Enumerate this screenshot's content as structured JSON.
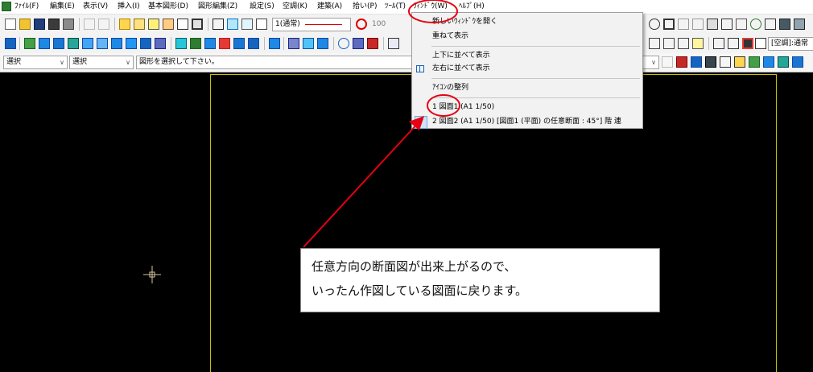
{
  "menubar": {
    "items": [
      "ﾌｧｲﾙ(F)",
      "編集(E)",
      "表示(V)",
      "挿入(I)",
      "基本図形(D)",
      "図形編集(Z)",
      "設定(S)",
      "空調(K)",
      "建築(A)",
      "拾い(P)",
      "ﾂｰﾙ(T)",
      "ｳｨﾝﾄﾞｳ(W)",
      "ﾍﾙﾌﾟ(H)"
    ]
  },
  "toolbar": {
    "layer_combo": "1(通常)",
    "zoom_value": "100",
    "layer_name": "[空調]:通常"
  },
  "selectbar": {
    "mode1": "選択",
    "mode2": "選択",
    "prompt": "図形を選択して下さい。"
  },
  "window_menu": {
    "new_window": "新しいｳｨﾝﾄﾞｳを開く",
    "cascade": "重ねて表示",
    "tile_horizontal": "上下に並べて表示",
    "tile_vertical": "左右に並べて表示",
    "arrange_icons": "ｱｲｺﾝの整列",
    "windows": [
      "1 図面1 (A1 1/50)",
      "2 図面2 (A1 1/50) [図面1 (平面) の任意断面 : 45°] 階 連"
    ]
  },
  "callout": {
    "line1": "任意方向の断面図が出来上がるので、",
    "line2": "いったん作図している図面に戻ります。"
  },
  "colors": {
    "annotation": "#e60012",
    "sheet_border": "#c9c000",
    "canvas": "#000000"
  }
}
